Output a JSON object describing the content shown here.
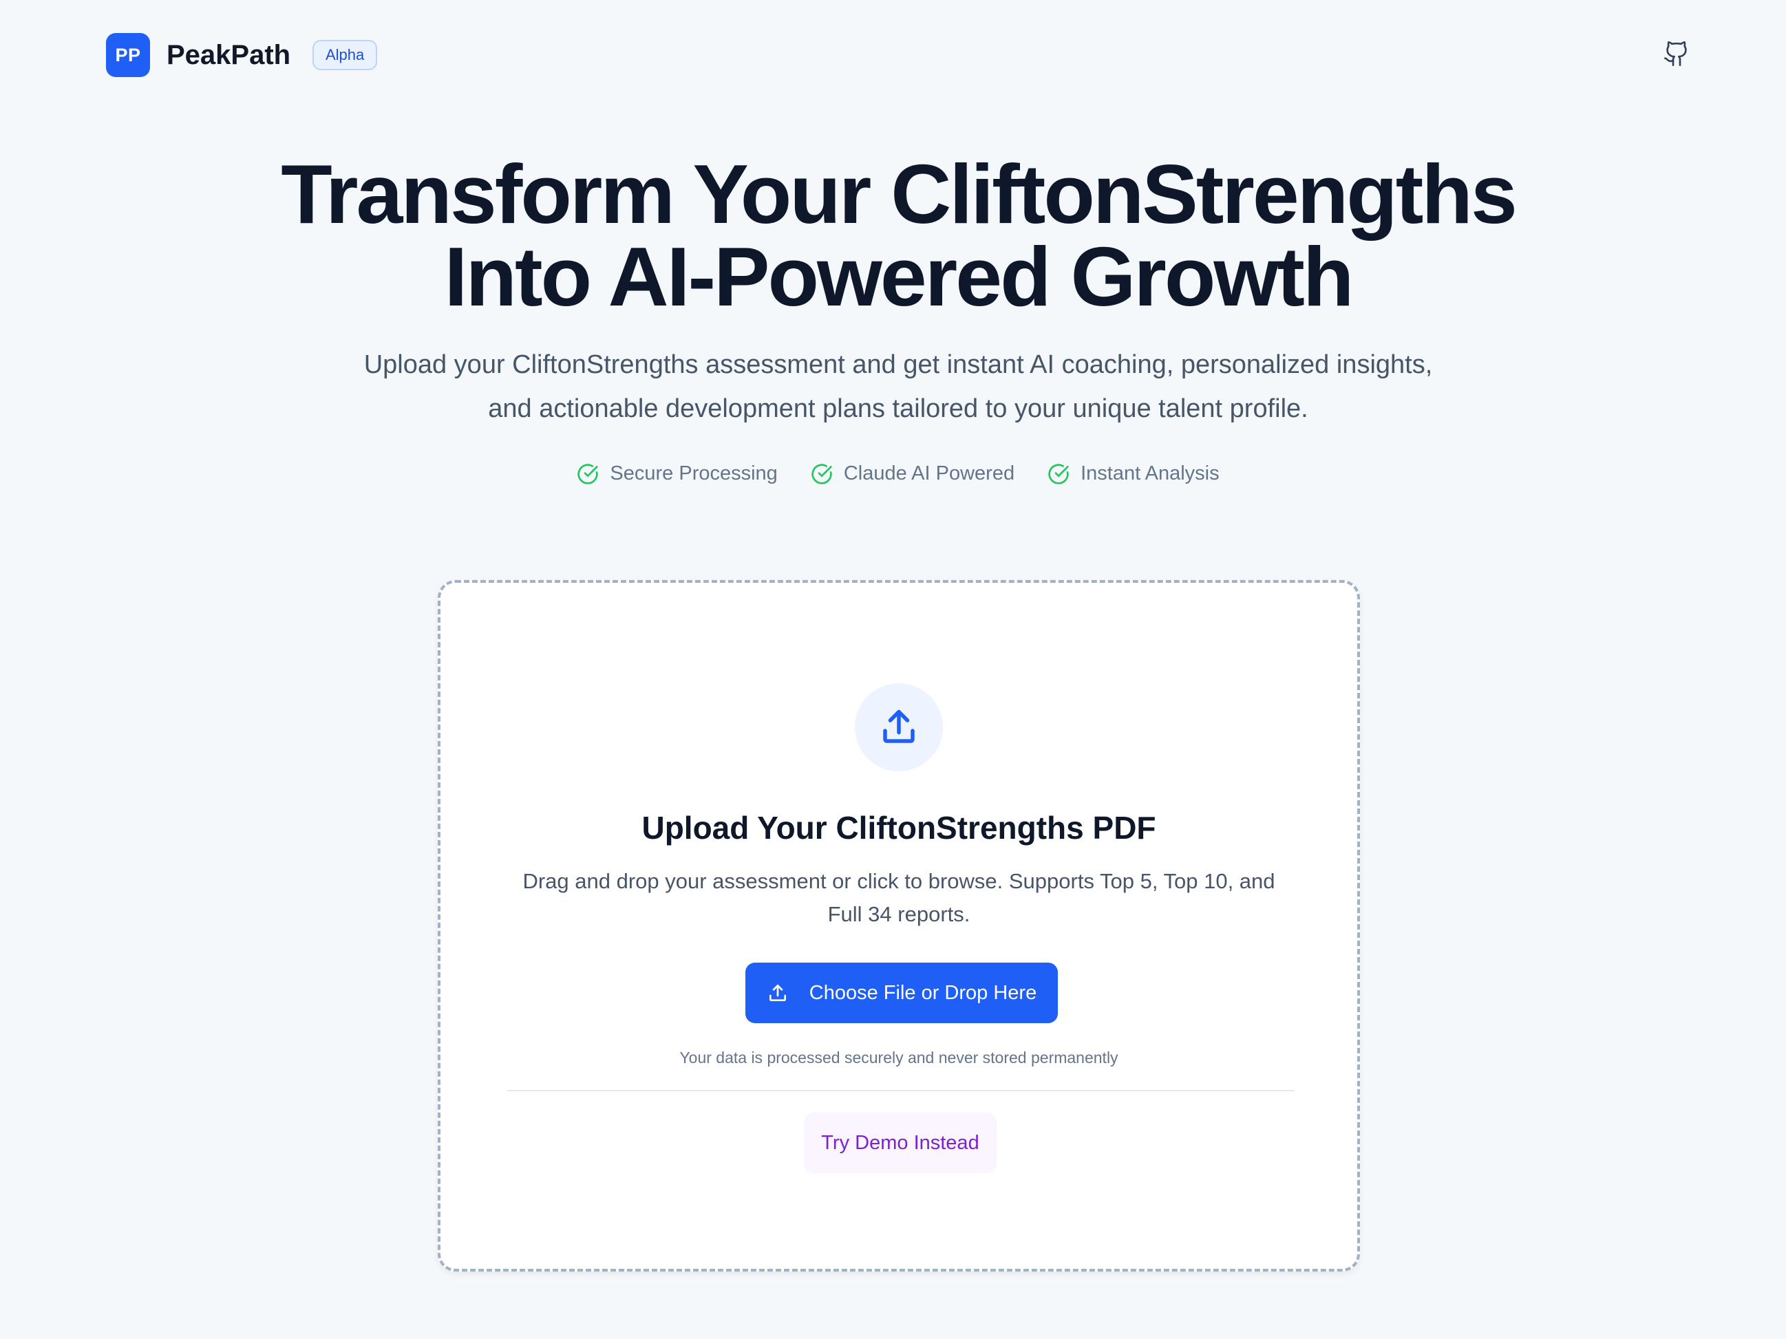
{
  "header": {
    "logo_initials": "PP",
    "brand_name": "PeakPath",
    "badge": "Alpha",
    "github_icon": "github-icon"
  },
  "hero": {
    "title_line1": "Transform Your CliftonStrengths",
    "title_line2": "Into AI-Powered Growth",
    "subtitle": "Upload your CliftonStrengths assessment and get instant AI coaching, personalized insights, and actionable development plans tailored to your unique talent profile.",
    "features": [
      {
        "icon": "check-circle-icon",
        "label": "Secure Processing"
      },
      {
        "icon": "check-circle-icon",
        "label": "Claude AI Powered"
      },
      {
        "icon": "check-circle-icon",
        "label": "Instant Analysis"
      }
    ]
  },
  "upload": {
    "icon": "upload-icon",
    "title": "Upload Your CliftonStrengths PDF",
    "description": "Drag and drop your assessment or click to browse. Supports Top 5, Top 10, and Full 34 reports.",
    "choose_button": "Choose File or Drop Here",
    "privacy_note": "Your data is processed securely and never stored permanently",
    "demo_button": "Try Demo Instead"
  },
  "colors": {
    "background": "#f5f8fa",
    "primary": "#1f5ff5",
    "check": "#22c55e",
    "demo_text": "#7e22ce",
    "demo_bg": "#fbf5ff"
  }
}
